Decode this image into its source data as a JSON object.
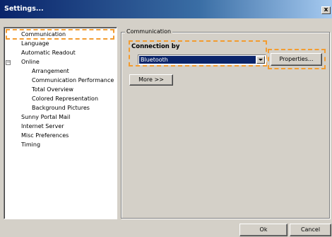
{
  "window": {
    "title": "Settings...",
    "close_label": "x"
  },
  "nav": {
    "items": [
      {
        "label": "Communication"
      },
      {
        "label": "Language"
      },
      {
        "label": "Automatic Readout"
      },
      {
        "label": "Online",
        "expand_glyph": "−"
      },
      {
        "label": "Arrangement"
      },
      {
        "label": "Communication Performance"
      },
      {
        "label": "Total Overview"
      },
      {
        "label": "Colored Representation"
      },
      {
        "label": "Background Pictures"
      },
      {
        "label": "Sunny Portal Mail"
      },
      {
        "label": "Internet Server"
      },
      {
        "label": "Misc Preferences"
      },
      {
        "label": "Timing"
      }
    ]
  },
  "main": {
    "group_label": "Communication",
    "connection_label": "Connection by",
    "connection_value": "Bluetooth",
    "properties_label": "Properties...",
    "more_label": "More >>"
  },
  "footer": {
    "ok_label": "Ok",
    "cancel_label": "Cancel"
  },
  "colors": {
    "highlight": "#f39c30",
    "selection": "#0a246a"
  }
}
